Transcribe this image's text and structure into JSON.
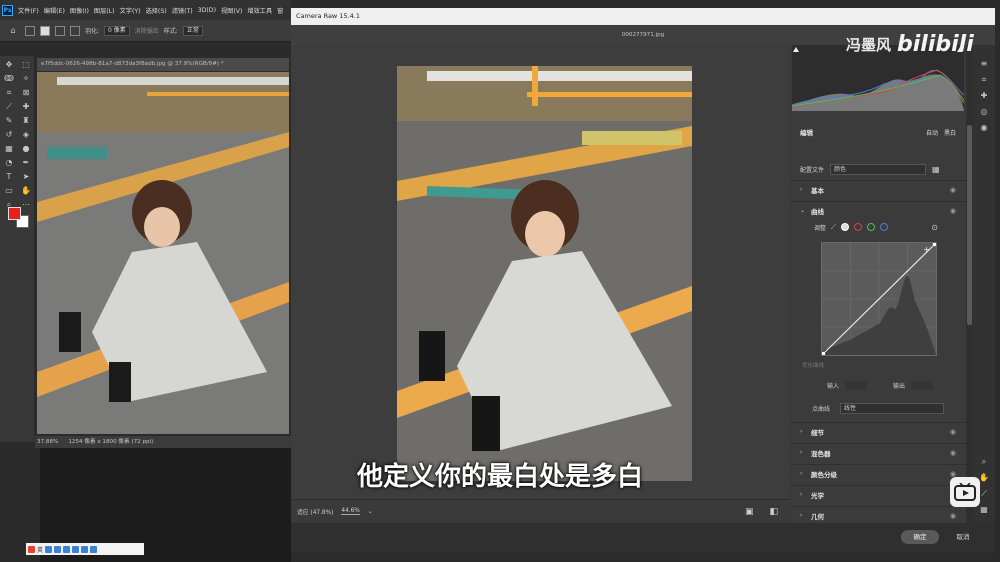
{
  "photoshop": {
    "logo": "Ps",
    "menu": [
      "文件(F)",
      "编辑(E)",
      "图像(I)",
      "图层(L)",
      "文字(Y)",
      "选择(S)",
      "滤镜(T)",
      "3D(D)",
      "视图(V)",
      "增效工具",
      "窗"
    ],
    "options": {
      "feather_label": "羽化:",
      "feather_value": "0 像素",
      "antialias": "消除锯齿",
      "style_label": "样式:",
      "style_value": "正常"
    },
    "doc_tab": "e7f5ddc-0626-498b-81a7-d873da3f8adb.jpg @ 37.9%(RGB/8#) *",
    "status_zoom": "37.88%",
    "status_info": "1254 像素 x 1800 像素 (72 ppi)",
    "ime_label": "英"
  },
  "camera_raw": {
    "title": "Camera Raw 15.4.1",
    "filename": "000277971.jpg",
    "zoom_fit": "适应 (47.8%)",
    "zoom_value": "44.6%",
    "ok": "确定",
    "cancel": "取消",
    "panel": {
      "edit": "编辑",
      "auto": "自动",
      "bw": "黑白",
      "profile_label": "配置文件",
      "profile_value": "颜色",
      "sections": [
        "基本",
        "曲线",
        "细节",
        "混色器",
        "颜色分级",
        "光学",
        "几何"
      ],
      "adjust_label": "调整",
      "refine_label": "优化曲线",
      "input_label": "输入",
      "output_label": "输出",
      "point_curve_label": "点曲线",
      "point_curve_value": "线性"
    }
  },
  "overlay": {
    "subtitle": "他定义你的最白处是多白",
    "uploader": "冯墨风",
    "platform": "bilibili"
  },
  "colors": {
    "foreground": "#e5211b",
    "background": "#ffffff"
  }
}
